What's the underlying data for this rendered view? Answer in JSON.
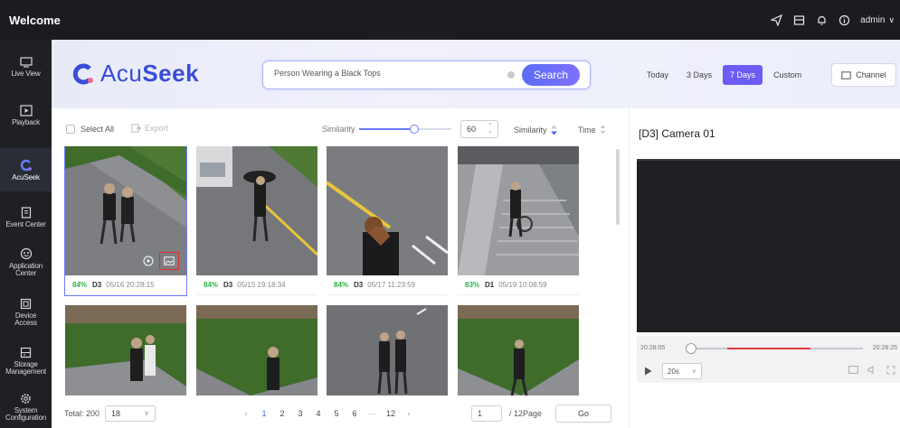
{
  "header": {
    "title": "Welcome",
    "user": "admin"
  },
  "sidebar": {
    "items": [
      {
        "label": "Live View",
        "icon": "monitor-icon"
      },
      {
        "label": "Playback",
        "icon": "play-square-icon"
      },
      {
        "label": "AcuSeek",
        "icon": "acuseek-icon",
        "active": true
      },
      {
        "label": "Event Center",
        "icon": "clipboard-icon"
      },
      {
        "label": "Application Center",
        "icon": "app-center-icon"
      },
      {
        "label": "Device Access",
        "icon": "device-icon"
      },
      {
        "label": "Storage Management",
        "icon": "storage-icon"
      },
      {
        "label": "System Configuration",
        "icon": "gear-icon"
      }
    ]
  },
  "logo": {
    "prefix": "Acu",
    "suffix": "Seek"
  },
  "search": {
    "value": "Person Wearing a Black Tops",
    "button": "Search"
  },
  "time_filters": [
    {
      "label": "Today"
    },
    {
      "label": "3 Days"
    },
    {
      "label": "7 Days",
      "active": true
    },
    {
      "label": "Custom"
    }
  ],
  "channel_label": "Channel",
  "toolbar": {
    "select_all": "Select All",
    "export": "Export",
    "similarity_label": "Similarity",
    "similarity_value": "60",
    "similarity_fraction": 0.6,
    "sort_similarity": "Similarity",
    "sort_time": "Time"
  },
  "results": [
    {
      "score": "84%",
      "camera": "D3",
      "time": "05/16 20:28:15",
      "selected": true,
      "scene": "park"
    },
    {
      "score": "84%",
      "camera": "D3",
      "time": "05/15 19:18:34",
      "scene": "road"
    },
    {
      "score": "84%",
      "camera": "D3",
      "time": "05/17 11:23:59",
      "scene": "road"
    },
    {
      "score": "83%",
      "camera": "D1",
      "time": "05/19 10:08:59",
      "scene": "stairs"
    },
    {
      "scene": "park"
    },
    {
      "scene": "park"
    },
    {
      "scene": "road"
    },
    {
      "scene": "park"
    }
  ],
  "pagination": {
    "total": "Total: 200",
    "page_size": "18",
    "pages": [
      "1",
      "2",
      "3",
      "4",
      "5",
      "6",
      "···",
      "12"
    ],
    "current_input": "1",
    "total_pages": "/ 12Page",
    "go": "Go"
  },
  "player": {
    "camera_title": "[D3] Camera 01",
    "start_time": "20:28:05",
    "end_time": "20:28:25",
    "speed": "20s"
  }
}
